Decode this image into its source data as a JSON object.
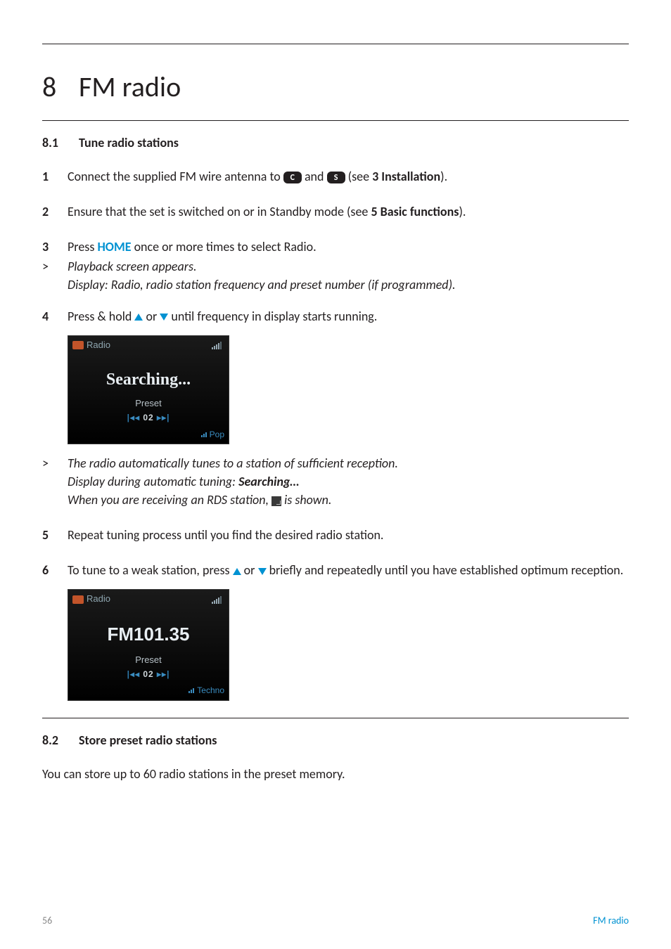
{
  "chapter": {
    "num": "8",
    "title": "FM radio"
  },
  "s81": {
    "num": "8.1",
    "title": "Tune radio stations",
    "step1_num": "1",
    "step1_a": "Connect the supplied FM wire antenna to ",
    "pill_c": "C",
    "step1_b": " and ",
    "pill_s": "S",
    "step1_c": " (see ",
    "step1_bold": "3 Installation",
    "step1_d": ").",
    "step2_num": "2",
    "step2_a": "Ensure that the set is switched on or in Standby mode (see ",
    "step2_bold": "5 Basic functions",
    "step2_b": ").",
    "step3_num": "3",
    "step3_a": "Press ",
    "step3_home": "HOME",
    "step3_b": " once or more times to select Radio.",
    "gt": ">",
    "step3_res1": "Playback screen appears.",
    "step3_res2": "Display: Radio, radio station frequency and preset number (if programmed).",
    "step4_num": "4",
    "step4_a": "Press & hold ",
    "step4_b": " or ",
    "step4_c": " until frequency in display starts running.",
    "lcd1": {
      "radio": "Radio",
      "main": "Searching...",
      "preset": "Preset",
      "nav_l": "◂◂",
      "nav_n": "02",
      "nav_r": "▸▸",
      "foot": "Pop"
    },
    "res_a": "The radio automatically tunes to a station of sufficient reception.",
    "res_b_pre": "Display during automatic tuning: ",
    "res_b_bold": "Searching…",
    "res_c_pre": "When you are receiving an RDS station, ",
    "res_c_post": " is shown.",
    "step5_num": "5",
    "step5": "Repeat tuning process until you find the desired radio station.",
    "step6_num": "6",
    "step6_a": "To tune to a weak station, press ",
    "step6_b": " or ",
    "step6_c": " briefly and repeatedly until you have established optimum reception.",
    "lcd2": {
      "radio": "Radio",
      "main": "FM101.35",
      "preset": "Preset",
      "nav_l": "◂◂",
      "nav_n": "02",
      "nav_r": "▸▸",
      "foot": "Techno"
    }
  },
  "s82": {
    "num": "8.2",
    "title": "Store preset radio stations",
    "body": "You can store up to 60 radio stations in the preset memory."
  },
  "footer": {
    "page": "56",
    "section": "FM radio"
  }
}
